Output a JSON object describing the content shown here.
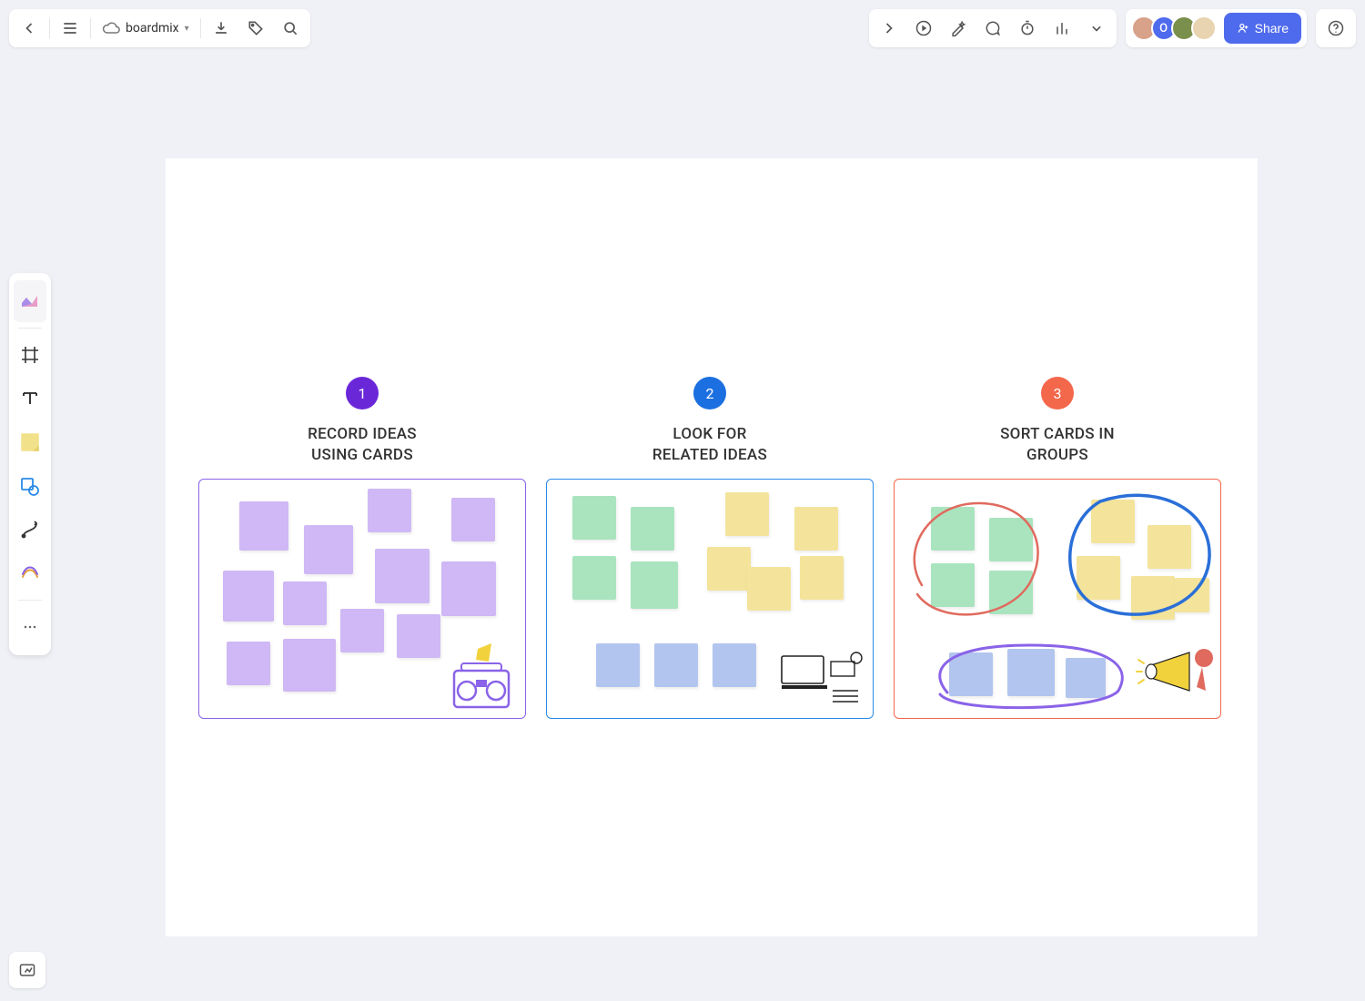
{
  "header": {
    "app_name": "boardmix",
    "share_label": "Share",
    "avatars": [
      {
        "initial": "",
        "color": "#d8a28a"
      },
      {
        "initial": "O",
        "color": "#4f6bed"
      },
      {
        "initial": "",
        "color": "#7a8f4b"
      },
      {
        "initial": "",
        "color": "#e8d4b0"
      }
    ]
  },
  "steps": [
    {
      "badge": "1",
      "title": "RECORD IDEAS\nUSING CARDS"
    },
    {
      "badge": "2",
      "title": "LOOK FOR\nRELATED IDEAS"
    },
    {
      "badge": "3",
      "title": "SORT CARDS IN\nGROUPS"
    }
  ]
}
